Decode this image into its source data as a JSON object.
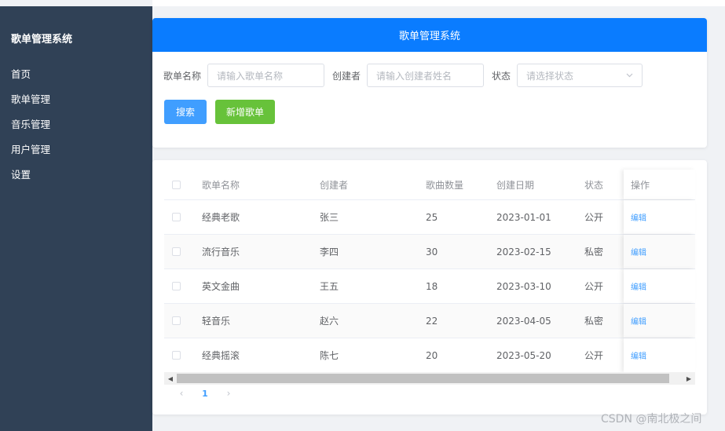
{
  "sidebar": {
    "brand": "歌单管理系统",
    "items": [
      {
        "label": "首页"
      },
      {
        "label": "歌单管理"
      },
      {
        "label": "音乐管理"
      },
      {
        "label": "用户管理"
      },
      {
        "label": "设置"
      }
    ]
  },
  "header": {
    "title": "歌单管理系统"
  },
  "search": {
    "name_label": "歌单名称",
    "name_placeholder": "请输入歌单名称",
    "creator_label": "创建者",
    "creator_placeholder": "请输入创建者姓名",
    "status_label": "状态",
    "status_placeholder": "请选择状态",
    "search_button": "搜索",
    "add_button": "新增歌单"
  },
  "table": {
    "columns": {
      "name": "歌单名称",
      "creator": "创建者",
      "count": "歌曲数量",
      "date": "创建日期",
      "status": "状态",
      "op": "操作"
    },
    "rows": [
      {
        "name": "经典老歌",
        "creator": "张三",
        "count": "25",
        "date": "2023-01-01",
        "status": "公开",
        "op": "编辑"
      },
      {
        "name": "流行音乐",
        "creator": "李四",
        "count": "30",
        "date": "2023-02-15",
        "status": "私密",
        "op": "编辑"
      },
      {
        "name": "英文金曲",
        "creator": "王五",
        "count": "18",
        "date": "2023-03-10",
        "status": "公开",
        "op": "编辑"
      },
      {
        "name": "轻音乐",
        "creator": "赵六",
        "count": "22",
        "date": "2023-04-05",
        "status": "私密",
        "op": "编辑"
      },
      {
        "name": "经典摇滚",
        "creator": "陈七",
        "count": "20",
        "date": "2023-05-20",
        "status": "公开",
        "op": "编辑"
      }
    ]
  },
  "pagination": {
    "prev": "‹",
    "current": "1",
    "next": "›"
  },
  "watermark": "CSDN @南北极之间",
  "colors": {
    "sidebar": "#304156",
    "header": "#0a7cff",
    "primary": "#409eff",
    "success": "#67c23a"
  }
}
